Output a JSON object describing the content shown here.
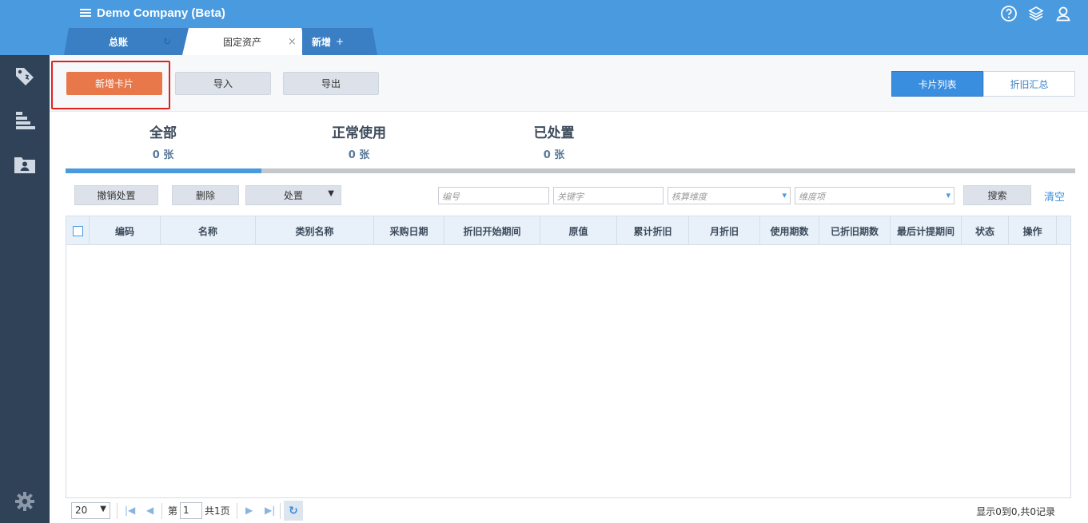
{
  "app": {
    "title": "Demo Company (Beta)"
  },
  "tabs": [
    {
      "label": "总账",
      "icon": "refresh-icon"
    },
    {
      "label": "固定资产",
      "icon": "close-icon",
      "close": "×"
    },
    {
      "label": "新增",
      "add": "+"
    }
  ],
  "header_icons": [
    "help-icon",
    "layers-icon",
    "user-icon"
  ],
  "sidebar": {
    "items": [
      "tag-icon",
      "report-icon",
      "folder-user-icon"
    ],
    "bottom": "gear-icon"
  },
  "toolbar": {
    "add_card": "新增卡片",
    "import": "导入",
    "export": "导出",
    "card_list": "卡片列表",
    "depreciation_summary": "折旧汇总"
  },
  "stats": [
    {
      "title": "全部",
      "value": "0 张"
    },
    {
      "title": "正常使用",
      "value": "0 张"
    },
    {
      "title": "已处置",
      "value": "0 张"
    }
  ],
  "progress": {
    "fraction": 0.194
  },
  "filters": {
    "undo_dispose": "撤销处置",
    "delete": "删除",
    "dispose": "处置",
    "code_placeholder": "编号",
    "keyword_placeholder": "关键字",
    "dimension_placeholder": "核算维度",
    "dimension_item_placeholder": "维度项",
    "search": "搜索",
    "clear": "清空"
  },
  "table": {
    "columns": [
      "编码",
      "名称",
      "类别名称",
      "采购日期",
      "折旧开始期间",
      "原值",
      "累计折旧",
      "月折旧",
      "使用期数",
      "已折旧期数",
      "最后计提期间",
      "状态",
      "操作"
    ],
    "rows": []
  },
  "pager": {
    "page_size": "20",
    "page_prefix": "第",
    "page": "1",
    "total_pages": "共1页",
    "info": "显示0到0,共0记录"
  },
  "colors": {
    "header": "#4a9ae0",
    "sidebar": "#2f4258",
    "primary_button": "#e8784a",
    "accent": "#3a8ee0",
    "highlight_box": "#e0221f"
  }
}
